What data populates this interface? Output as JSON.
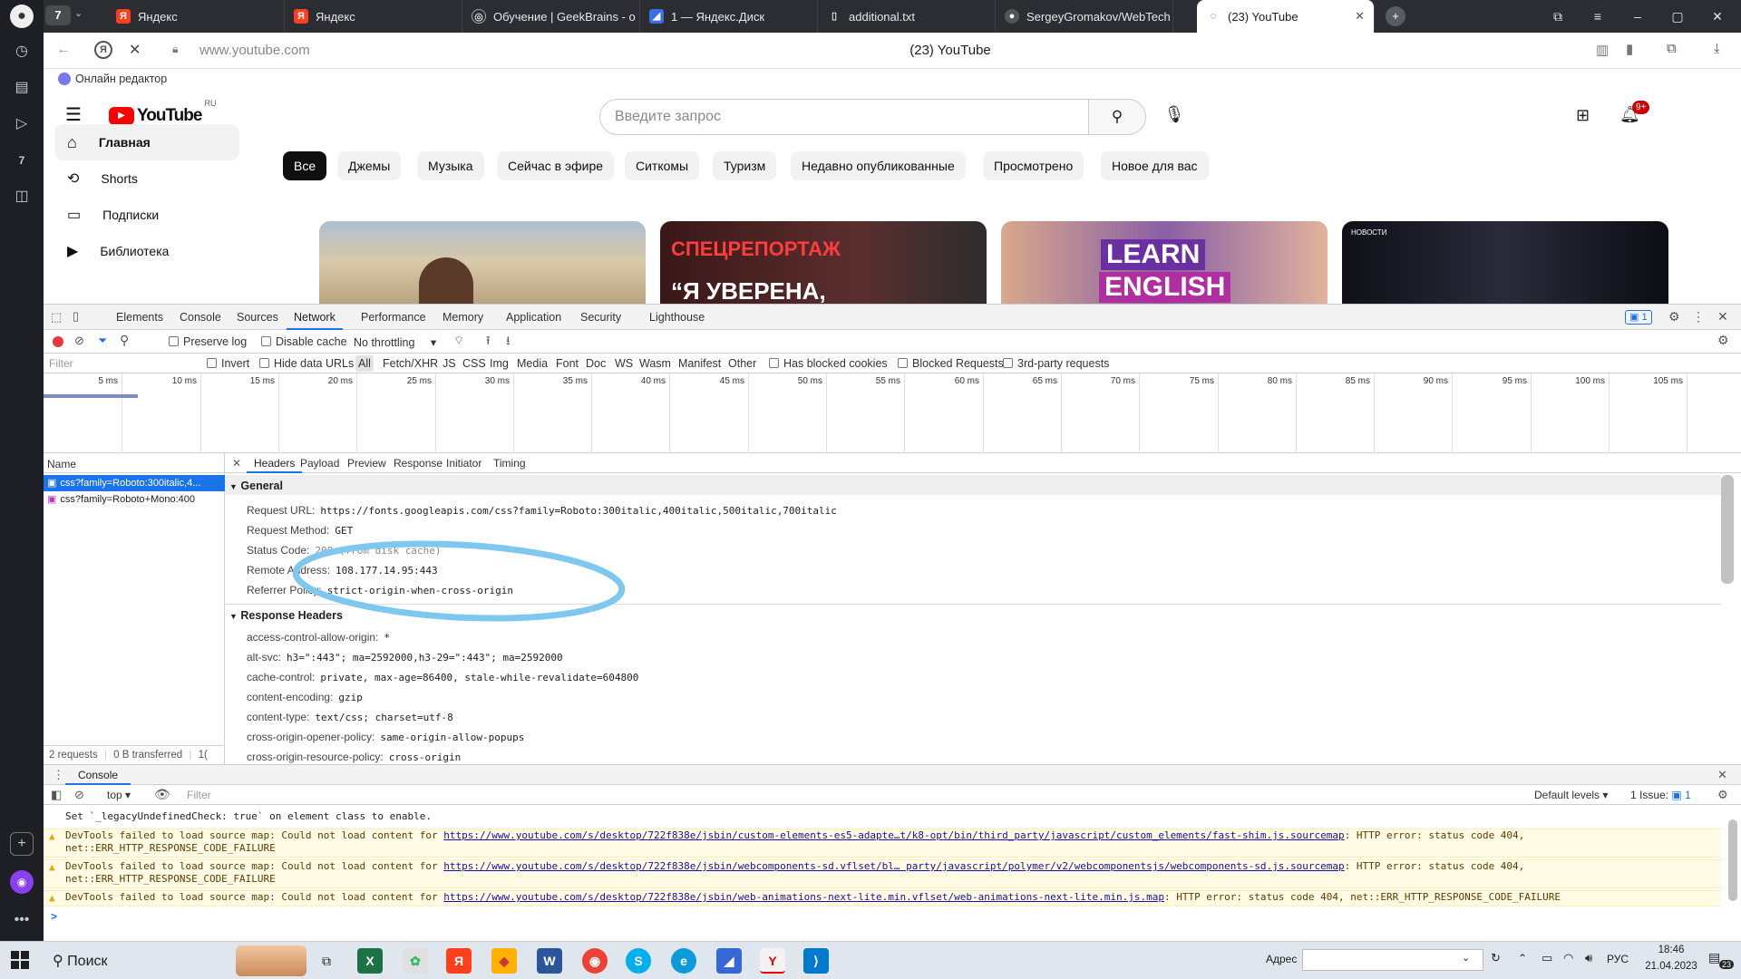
{
  "browser": {
    "tab_count": "7",
    "tabs": [
      {
        "title": "Яндекс",
        "icon": "yandex-icon"
      },
      {
        "title": "Яндекс",
        "icon": "yandex-icon"
      },
      {
        "title": "Обучение | GeekBrains - о",
        "icon": "geekbrains-icon"
      },
      {
        "title": "1 — Яндекс.Диск",
        "icon": "yandex-disk-icon"
      },
      {
        "title": "additional.txt",
        "icon": "file-icon"
      },
      {
        "title": "SergeyGromakov/WebTech",
        "icon": "github-icon"
      },
      {
        "title": "(23) YouTube",
        "icon": "loading-icon",
        "active": true
      }
    ],
    "url": "www.youtube.com",
    "page_title": "(23) YouTube",
    "bookmark": "Онлайн редактор"
  },
  "youtube": {
    "logo": "YouTube",
    "region": "RU",
    "search_placeholder": "Введите запрос",
    "notif_badge": "9+",
    "nav": [
      "Главная",
      "Shorts",
      "Подписки",
      "Библиотека"
    ],
    "chips": [
      "Все",
      "Джемы",
      "Музыка",
      "Сейчас в эфире",
      "Ситкомы",
      "Туризм",
      "Недавно опубликованные",
      "Просмотрено",
      "Новое для вас"
    ],
    "thumbs": [
      {
        "caption": ""
      },
      {
        "caption1": "СПЕЦРЕПОРТАЖ",
        "caption2": "“Я УВЕРЕНА,"
      },
      {
        "caption1": "LEARN",
        "caption2": "ENGLISH"
      },
      {
        "caption": "НОВОСТИ"
      }
    ]
  },
  "devtools": {
    "tabs": [
      "Elements",
      "Console",
      "Sources",
      "Network",
      "Performance",
      "Memory",
      "Application",
      "Security",
      "Lighthouse"
    ],
    "active_tab": "Network",
    "issues_badge": "1",
    "toolbar": {
      "preserve_log": "Preserve log",
      "disable_cache": "Disable cache",
      "throttling": "No throttling"
    },
    "filter_placeholder": "Filter",
    "filter_row": [
      "Invert",
      "Hide data URLs",
      "All",
      "Fetch/XHR",
      "JS",
      "CSS",
      "Img",
      "Media",
      "Font",
      "Doc",
      "WS",
      "Wasm",
      "Manifest",
      "Other",
      "Has blocked cookies",
      "Blocked Requests",
      "3rd-party requests"
    ],
    "timeline_ticks": [
      "5 ms",
      "10 ms",
      "15 ms",
      "20 ms",
      "25 ms",
      "30 ms",
      "35 ms",
      "40 ms",
      "45 ms",
      "50 ms",
      "55 ms",
      "60 ms",
      "65 ms",
      "70 ms",
      "75 ms",
      "80 ms",
      "85 ms",
      "90 ms",
      "95 ms",
      "100 ms",
      "105 ms"
    ],
    "name_header": "Name",
    "requests": [
      "css?family=Roboto:300italic,4...",
      "css?family=Roboto+Mono:400"
    ],
    "footer": [
      "2 requests",
      "0 B transferred",
      "1("
    ],
    "detail_tabs": [
      "Headers",
      "Payload",
      "Preview",
      "Response",
      "Initiator",
      "Timing"
    ],
    "general_title": "General",
    "general": [
      {
        "k": "Request URL:",
        "v": "https://fonts.googleapis.com/css?family=Roboto:300italic,400italic,500italic,700italic"
      },
      {
        "k": "Request Method:",
        "v": "GET"
      },
      {
        "k": "Status Code:",
        "v": "200  (from disk cache)"
      },
      {
        "k": "Remote Address:",
        "v": "108.177.14.95:443"
      },
      {
        "k": "Referrer Policy:",
        "v": "strict-origin-when-cross-origin"
      }
    ],
    "response_title": "Response Headers",
    "response": [
      {
        "k": "access-control-allow-origin:",
        "v": "*"
      },
      {
        "k": "alt-svc:",
        "v": "h3=\":443\"; ma=2592000,h3-29=\":443\"; ma=2592000"
      },
      {
        "k": "cache-control:",
        "v": "private, max-age=86400, stale-while-revalidate=604800"
      },
      {
        "k": "content-encoding:",
        "v": "gzip"
      },
      {
        "k": "content-type:",
        "v": "text/css; charset=utf-8"
      },
      {
        "k": "cross-origin-opener-policy:",
        "v": "same-origin-allow-popups"
      },
      {
        "k": "cross-origin-resource-policy:",
        "v": "cross-origin"
      }
    ]
  },
  "console": {
    "title": "Console",
    "context": "top",
    "filter_placeholder": "Filter",
    "levels": "Default levels",
    "issues": "1 Issue:",
    "issues_count": "1",
    "lines": [
      {
        "type": "info",
        "pre": "Set `_legacyUndefinedCheck: true` on element class to enable.",
        "link": "",
        "post": "",
        "line2": ""
      },
      {
        "type": "warn",
        "pre": "DevTools failed to load source map: Could not load content for ",
        "link": "https://www.youtube.com/s/desktop/722f838e/jsbin/custom-elements-es5-adapte…t/k8-opt/bin/third_party/javascript/custom_elements/fast-shim.js.sourcemap",
        "post": ": HTTP error: status code 404,",
        "line2": "net::ERR_HTTP_RESPONSE_CODE_FAILURE"
      },
      {
        "type": "warn",
        "pre": "DevTools failed to load source map: Could not load content for ",
        "link": "https://www.youtube.com/s/desktop/722f838e/jsbin/webcomponents-sd.vflset/bl… party/javascript/polymer/v2/webcomponentsjs/webcomponents-sd.js.sourcemap",
        "post": ": HTTP error: status code 404,",
        "line2": "net::ERR_HTTP_RESPONSE_CODE_FAILURE"
      },
      {
        "type": "warn",
        "pre": "DevTools failed to load source map: Could not load content for ",
        "link": "https://www.youtube.com/s/desktop/722f838e/jsbin/web-animations-next-lite.min.vflset/web-animations-next-lite.min.js.map",
        "post": ": HTTP error: status code 404, net::ERR_HTTP_RESPONSE_CODE_FAILURE",
        "line2": ""
      }
    ],
    "prompt": ">"
  },
  "taskbar": {
    "search": "Поиск",
    "address_label": "Адрес",
    "lang": "РУС",
    "time": "18:46",
    "date": "21.04.2023",
    "notif": "23"
  },
  "colors": {
    "yt_red": "#ff0000",
    "devtools_accent": "#1a73e8",
    "annotation": "#7ec8f0"
  }
}
